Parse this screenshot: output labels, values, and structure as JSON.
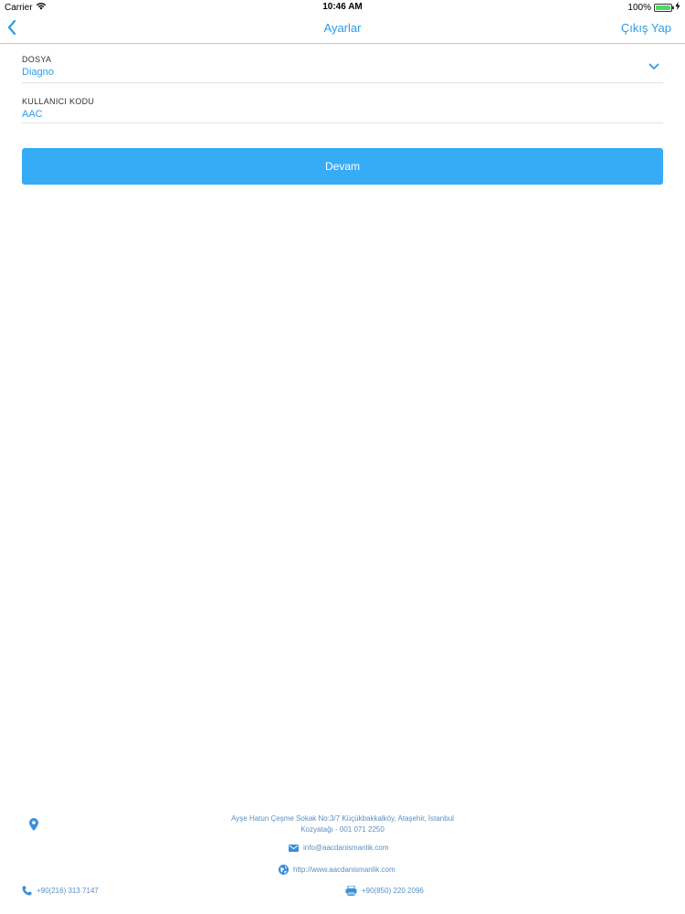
{
  "status_bar": {
    "carrier": "Carrier",
    "time": "10:46 AM",
    "battery_pct": "100%",
    "battery_level": 1.0
  },
  "nav": {
    "title": "Ayarlar",
    "right_action": "Çıkış Yap"
  },
  "form": {
    "dosya": {
      "label": "DOSYA",
      "value": "Diagno"
    },
    "kullanici_kodu": {
      "label": "KULLANICI KODU",
      "value": "AAC"
    },
    "submit_label": "Devam"
  },
  "footer": {
    "address_line1": "Ayşe Hatun Çeşme Sokak No:3/7 Küçükbakkalköy, Ataşehir, İstanbul",
    "address_line2": "Kozyatağı - 001 071 2250",
    "email": "info@aacdanismanlik.com",
    "website": "http://www.aacdanismanlik.com",
    "phone": "+90(216) 313 7147",
    "fax": "+90(850) 220 2096"
  },
  "colors": {
    "accent": "#2b9be8",
    "button": "#35acf5",
    "footer_text": "#5a8fc4"
  }
}
